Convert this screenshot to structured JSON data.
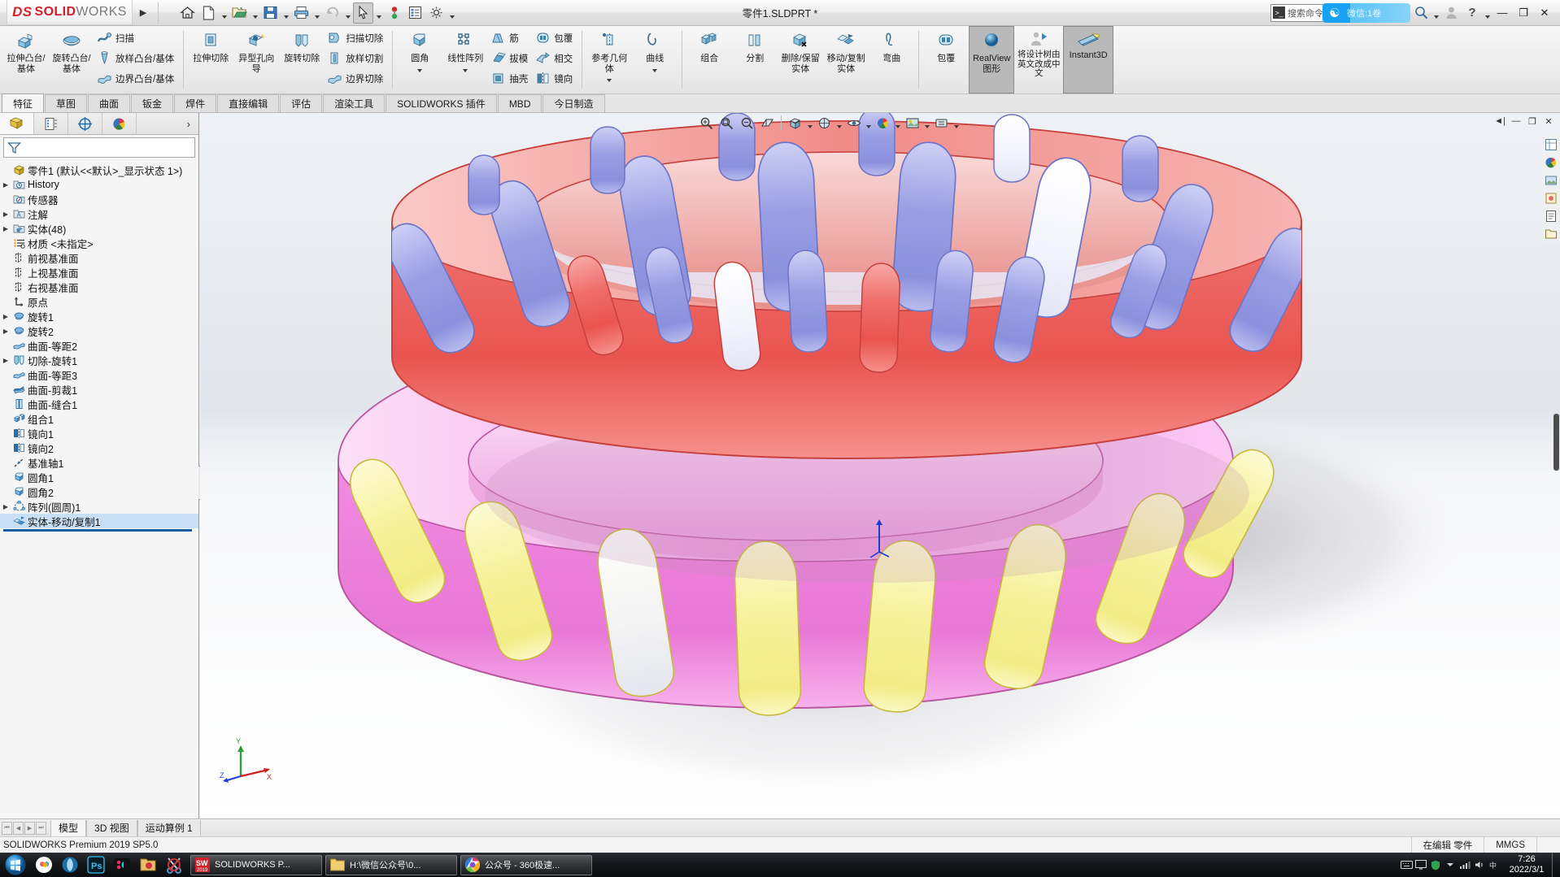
{
  "titlebar": {
    "logo": {
      "ds": "DS",
      "solid": "SOLID",
      "works": "WORKS"
    },
    "doc_title": "零件1.SLDPRT *",
    "search_placeholder": "搜索命令",
    "wechat_label": "微信:1卷",
    "icons": [
      {
        "name": "home-icon",
        "label": "主页"
      },
      {
        "name": "new-document-icon",
        "label": "新建"
      },
      {
        "name": "open-folder-icon",
        "label": "打开"
      },
      {
        "name": "save-icon",
        "label": "保存"
      },
      {
        "name": "print-icon",
        "label": "打印"
      },
      {
        "name": "undo-icon",
        "label": "撤销"
      },
      {
        "name": "select-cursor-icon",
        "label": "选择"
      },
      {
        "name": "rebuild-icon",
        "label": "重建模型"
      },
      {
        "name": "file-properties-icon",
        "label": "文件属性"
      },
      {
        "name": "options-gear-icon",
        "label": "选项"
      }
    ],
    "window_buttons": {
      "minimize": "—",
      "restore": "❐",
      "close": "✕"
    },
    "help_label": "?",
    "account_label": "账户"
  },
  "ribbon": {
    "groups": [
      {
        "name": "boss-base-group",
        "big": [
          {
            "label": "拉伸凸台/基体",
            "icon": "extrude-boss-icon"
          },
          {
            "label": "旋转凸台/基体",
            "icon": "revolve-boss-icon"
          }
        ],
        "small": [
          {
            "label": "扫描",
            "icon": "sweep-icon"
          },
          {
            "label": "放样凸台/基体",
            "icon": "loft-icon"
          },
          {
            "label": "边界凸台/基体",
            "icon": "boundary-boss-icon"
          }
        ]
      },
      {
        "name": "cut-group",
        "big": [
          {
            "label": "拉伸切除",
            "icon": "extrude-cut-icon"
          },
          {
            "label": "异型孔向导",
            "icon": "hole-wizard-icon"
          },
          {
            "label": "旋转切除",
            "icon": "revolve-cut-icon"
          }
        ],
        "small": [
          {
            "label": "扫描切除",
            "icon": "swept-cut-icon"
          },
          {
            "label": "放样切割",
            "icon": "lofted-cut-icon"
          },
          {
            "label": "边界切除",
            "icon": "boundary-cut-icon"
          }
        ]
      },
      {
        "name": "feature-group",
        "big": [
          {
            "label": "圆角",
            "icon": "fillet-icon"
          },
          {
            "label": "线性阵列",
            "icon": "linear-pattern-icon"
          }
        ],
        "small": [
          {
            "label": "筋",
            "icon": "rib-icon"
          },
          {
            "label": "拔模",
            "icon": "draft-icon"
          },
          {
            "label": "抽壳",
            "icon": "shell-icon"
          }
        ],
        "small2": [
          {
            "label": "包覆",
            "icon": "wrap-icon"
          },
          {
            "label": "相交",
            "icon": "intersect-icon"
          },
          {
            "label": "镜向",
            "icon": "mirror-icon"
          }
        ]
      },
      {
        "name": "reference-group",
        "big": [
          {
            "label": "参考几何体",
            "icon": "reference-geometry-icon"
          },
          {
            "label": "曲线",
            "icon": "curves-icon"
          }
        ]
      },
      {
        "name": "bodies-group",
        "big": [
          {
            "label": "组合",
            "icon": "combine-icon"
          },
          {
            "label": "分割",
            "icon": "split-icon"
          },
          {
            "label": "删除/保留实体",
            "icon": "delete-keep-body-icon"
          },
          {
            "label": "移动/复制实体",
            "icon": "move-copy-body-icon"
          },
          {
            "label": "弯曲",
            "icon": "flex-icon"
          }
        ]
      },
      {
        "name": "display-group",
        "big": [
          {
            "label": "包覆",
            "icon": "wrap2-icon"
          },
          {
            "label": "RealView 图形",
            "icon": "realview-icon",
            "active": true
          },
          {
            "label": "将设计树由英文改成中文",
            "icon": "tree-language-icon"
          },
          {
            "label": "Instant3D",
            "icon": "instant3d-icon",
            "active": true
          }
        ]
      }
    ]
  },
  "command_tabs": [
    {
      "label": "特征",
      "active": true
    },
    {
      "label": "草图",
      "active": false
    },
    {
      "label": "曲面",
      "active": false
    },
    {
      "label": "钣金",
      "active": false
    },
    {
      "label": "焊件",
      "active": false
    },
    {
      "label": "直接编辑",
      "active": false
    },
    {
      "label": "评估",
      "active": false
    },
    {
      "label": "渲染工具",
      "active": false
    },
    {
      "label": "SOLIDWORKS 插件",
      "active": false
    },
    {
      "label": "MBD",
      "active": false
    },
    {
      "label": "今日制造",
      "active": false
    }
  ],
  "tree_panel": {
    "tabs": [
      {
        "name": "feature-manager-tab",
        "icon": "feature-tree-icon",
        "active": true
      },
      {
        "name": "property-manager-tab",
        "icon": "property-manager-icon",
        "active": false
      },
      {
        "name": "configuration-manager-tab",
        "icon": "configuration-icon",
        "active": false
      },
      {
        "name": "display-manager-tab",
        "icon": "display-manager-icon",
        "active": false
      }
    ],
    "expand_arrow": "›",
    "filter_icon": "filter-funnel-icon",
    "root": "零件1  (默认<<默认>_显示状态 1>)",
    "items": [
      {
        "label": "History",
        "icon": "history-icon",
        "expandable": true,
        "indent": 1
      },
      {
        "label": "传感器",
        "icon": "sensors-icon",
        "expandable": false,
        "indent": 1
      },
      {
        "label": "注解",
        "icon": "annotations-icon",
        "expandable": true,
        "indent": 1
      },
      {
        "label": "实体(48)",
        "icon": "solid-bodies-icon",
        "expandable": true,
        "indent": 1
      },
      {
        "label": "材质 <未指定>",
        "icon": "material-icon",
        "expandable": false,
        "indent": 1
      },
      {
        "label": "前视基准面",
        "icon": "plane-icon",
        "expandable": false,
        "indent": 1
      },
      {
        "label": "上视基准面",
        "icon": "plane-icon",
        "expandable": false,
        "indent": 1
      },
      {
        "label": "右视基准面",
        "icon": "plane-icon",
        "expandable": false,
        "indent": 1
      },
      {
        "label": "原点",
        "icon": "origin-icon",
        "expandable": false,
        "indent": 1
      },
      {
        "label": "旋转1",
        "icon": "revolve-feature-icon",
        "expandable": true,
        "indent": 1
      },
      {
        "label": "旋转2",
        "icon": "revolve-feature-icon",
        "expandable": true,
        "indent": 1
      },
      {
        "label": "曲面-等距2",
        "icon": "offset-surface-icon",
        "expandable": false,
        "indent": 1
      },
      {
        "label": "切除-旋转1",
        "icon": "revolve-cut-feature-icon",
        "expandable": true,
        "indent": 1
      },
      {
        "label": "曲面-等距3",
        "icon": "offset-surface-icon",
        "expandable": false,
        "indent": 1
      },
      {
        "label": "曲面-剪裁1",
        "icon": "trim-surface-icon",
        "expandable": false,
        "indent": 1
      },
      {
        "label": "曲面-缝合1",
        "icon": "knit-surface-icon",
        "expandable": false,
        "indent": 1
      },
      {
        "label": "组合1",
        "icon": "combine-feature-icon",
        "expandable": false,
        "indent": 1
      },
      {
        "label": "镜向1",
        "icon": "mirror-feature-icon",
        "expandable": false,
        "indent": 1
      },
      {
        "label": "镜向2",
        "icon": "mirror-feature-icon",
        "expandable": false,
        "indent": 1
      },
      {
        "label": "基准轴1",
        "icon": "axis-icon",
        "expandable": false,
        "indent": 1
      },
      {
        "label": "圆角1",
        "icon": "fillet-feature-icon",
        "expandable": false,
        "indent": 1
      },
      {
        "label": "圆角2",
        "icon": "fillet-feature-icon",
        "expandable": false,
        "indent": 1
      },
      {
        "label": "阵列(圆周)1",
        "icon": "circular-pattern-icon",
        "expandable": true,
        "indent": 1
      },
      {
        "label": "实体-移动/复制1",
        "icon": "move-copy-feature-icon",
        "expandable": false,
        "indent": 1,
        "selected": true
      }
    ]
  },
  "view_toolbar": [
    {
      "name": "zoom-to-fit-icon"
    },
    {
      "name": "zoom-to-area-icon"
    },
    {
      "name": "previous-view-icon"
    },
    {
      "name": "section-view-icon"
    },
    {
      "name": "view-orientation-icon",
      "caret": true
    },
    {
      "name": "display-style-icon",
      "caret": true
    },
    {
      "name": "hide-show-items-icon",
      "caret": true
    },
    {
      "name": "edit-appearance-icon",
      "caret": true
    },
    {
      "name": "apply-scene-icon",
      "caret": true
    },
    {
      "name": "view-settings-icon",
      "caret": true
    }
  ],
  "right_dock": [
    {
      "name": "view-palette-icon"
    },
    {
      "name": "appearances-icon"
    },
    {
      "name": "scenes-icon"
    },
    {
      "name": "decals-icon"
    },
    {
      "name": "custom-properties-icon"
    },
    {
      "name": "design-library-icon"
    }
  ],
  "graphics": {
    "triad_labels": {
      "x": "X",
      "y": "Y",
      "z": "Z"
    },
    "origin_marker": "part-origin-triad"
  },
  "bottom_tabs": {
    "nav": [
      "⏮",
      "◀",
      "▶",
      "⏭"
    ],
    "tabs": [
      {
        "label": "模型",
        "active": true
      },
      {
        "label": "3D 视图",
        "active": false
      },
      {
        "label": "运动算例 1",
        "active": false
      }
    ]
  },
  "statusbar": {
    "left": "SOLIDWORKS Premium 2019 SP5.0",
    "right": [
      {
        "label": "在编辑 零件"
      },
      {
        "label": "MMGS"
      },
      {
        "label": ""
      }
    ]
  },
  "taskbar": {
    "start": "start-orb-icon",
    "quick_launch": [
      {
        "name": "wechat-devtools-icon"
      },
      {
        "name": "browser-icon"
      },
      {
        "name": "photoshop-icon"
      },
      {
        "name": "media-player-icon"
      },
      {
        "name": "folder-red-icon"
      },
      {
        "name": "snip-tool-icon"
      }
    ],
    "tasks": [
      {
        "label": "SOLIDWORKS P...",
        "icon": "solidworks-2019-icon"
      },
      {
        "label": "H:\\微信公众号\\0...",
        "icon": "folder-icon"
      },
      {
        "label": "公众号 - 360极速...",
        "icon": "chrome-360-icon"
      }
    ],
    "tray": [
      {
        "name": "tray-keyboard-icon"
      },
      {
        "name": "tray-screen-icon"
      },
      {
        "name": "tray-shield-icon"
      },
      {
        "name": "tray-arrow-icon"
      },
      {
        "name": "tray-network-icon"
      },
      {
        "name": "tray-volume-icon"
      },
      {
        "name": "tray-lang-icon"
      }
    ],
    "clock_time": "7:26",
    "clock_date": "2022/3/1"
  }
}
